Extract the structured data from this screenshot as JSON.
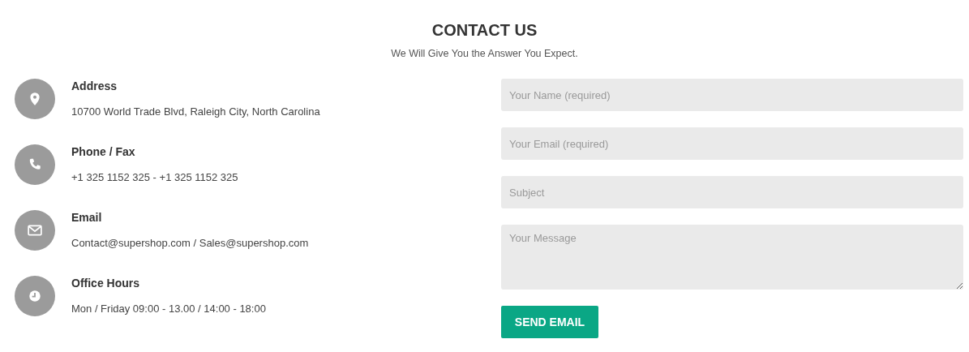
{
  "header": {
    "title": "CONTACT US",
    "subtitle": "We Will Give You the Answer You Expect."
  },
  "contact_items": [
    {
      "kind": "pin",
      "label": "Address",
      "value": "10700 World Trade Blvd, Raleigh City, North Carolina"
    },
    {
      "kind": "phone",
      "label": "Phone / Fax",
      "value": "+1 325 1152 325 - +1 325 1152 325"
    },
    {
      "kind": "mail",
      "label": "Email",
      "value": "Contact@supershop.com / Sales@supershop.com"
    },
    {
      "kind": "clock",
      "label": "Office Hours",
      "value": "Mon / Friday 09:00 - 13.00 / 14:00 - 18:00"
    }
  ],
  "form": {
    "fields": [
      {
        "kind": "input",
        "placeholder": "Your Name (required)"
      },
      {
        "kind": "input",
        "placeholder": "Your Email (required)"
      },
      {
        "kind": "input",
        "placeholder": "Subject"
      },
      {
        "kind": "textarea",
        "placeholder": "Your Message"
      }
    ],
    "submit": "SEND EMAIL"
  }
}
